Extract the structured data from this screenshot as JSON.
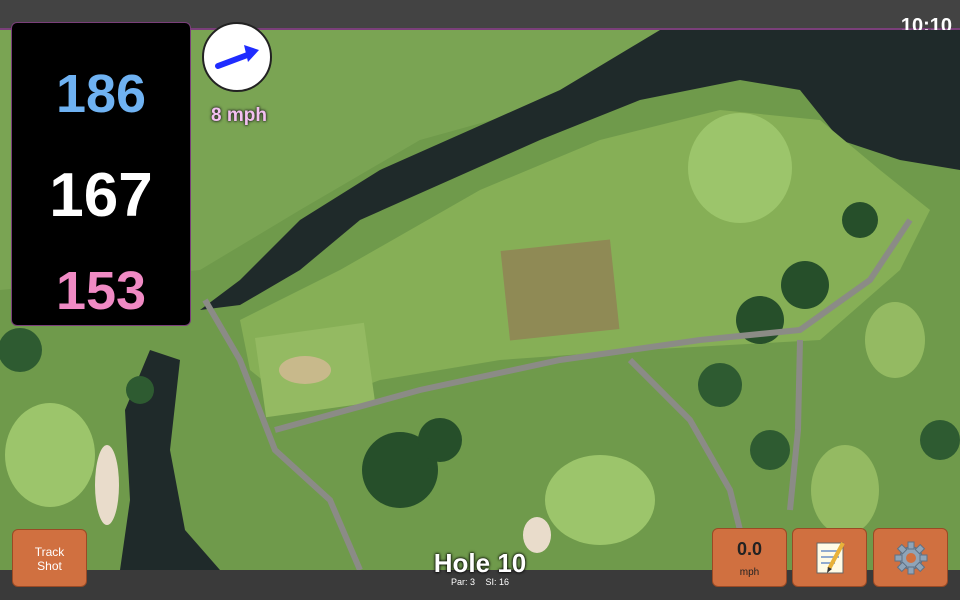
{
  "status_bar": {
    "time": "10:10"
  },
  "distances": {
    "back": "186",
    "middle": "167",
    "front": "153"
  },
  "wind": {
    "speed_label": "8 mph",
    "direction_icon": "wind-arrow-icon",
    "arrow_color": "#1f2cff"
  },
  "buttons": {
    "track_shot": {
      "line1": "Track",
      "line2": "Shot"
    },
    "speed": {
      "value": "0.0",
      "unit": "mph"
    },
    "notes_icon": "notepad-icon",
    "settings_icon": "gear-icon"
  },
  "hole": {
    "title": "Hole 10",
    "par": "Par: 3",
    "si": "SI: 16"
  },
  "colors": {
    "back": "#6fb2f2",
    "middle": "#ffffff",
    "front": "#f08ac4",
    "button": "#d07040",
    "accent_border": "#7a3f7a"
  }
}
